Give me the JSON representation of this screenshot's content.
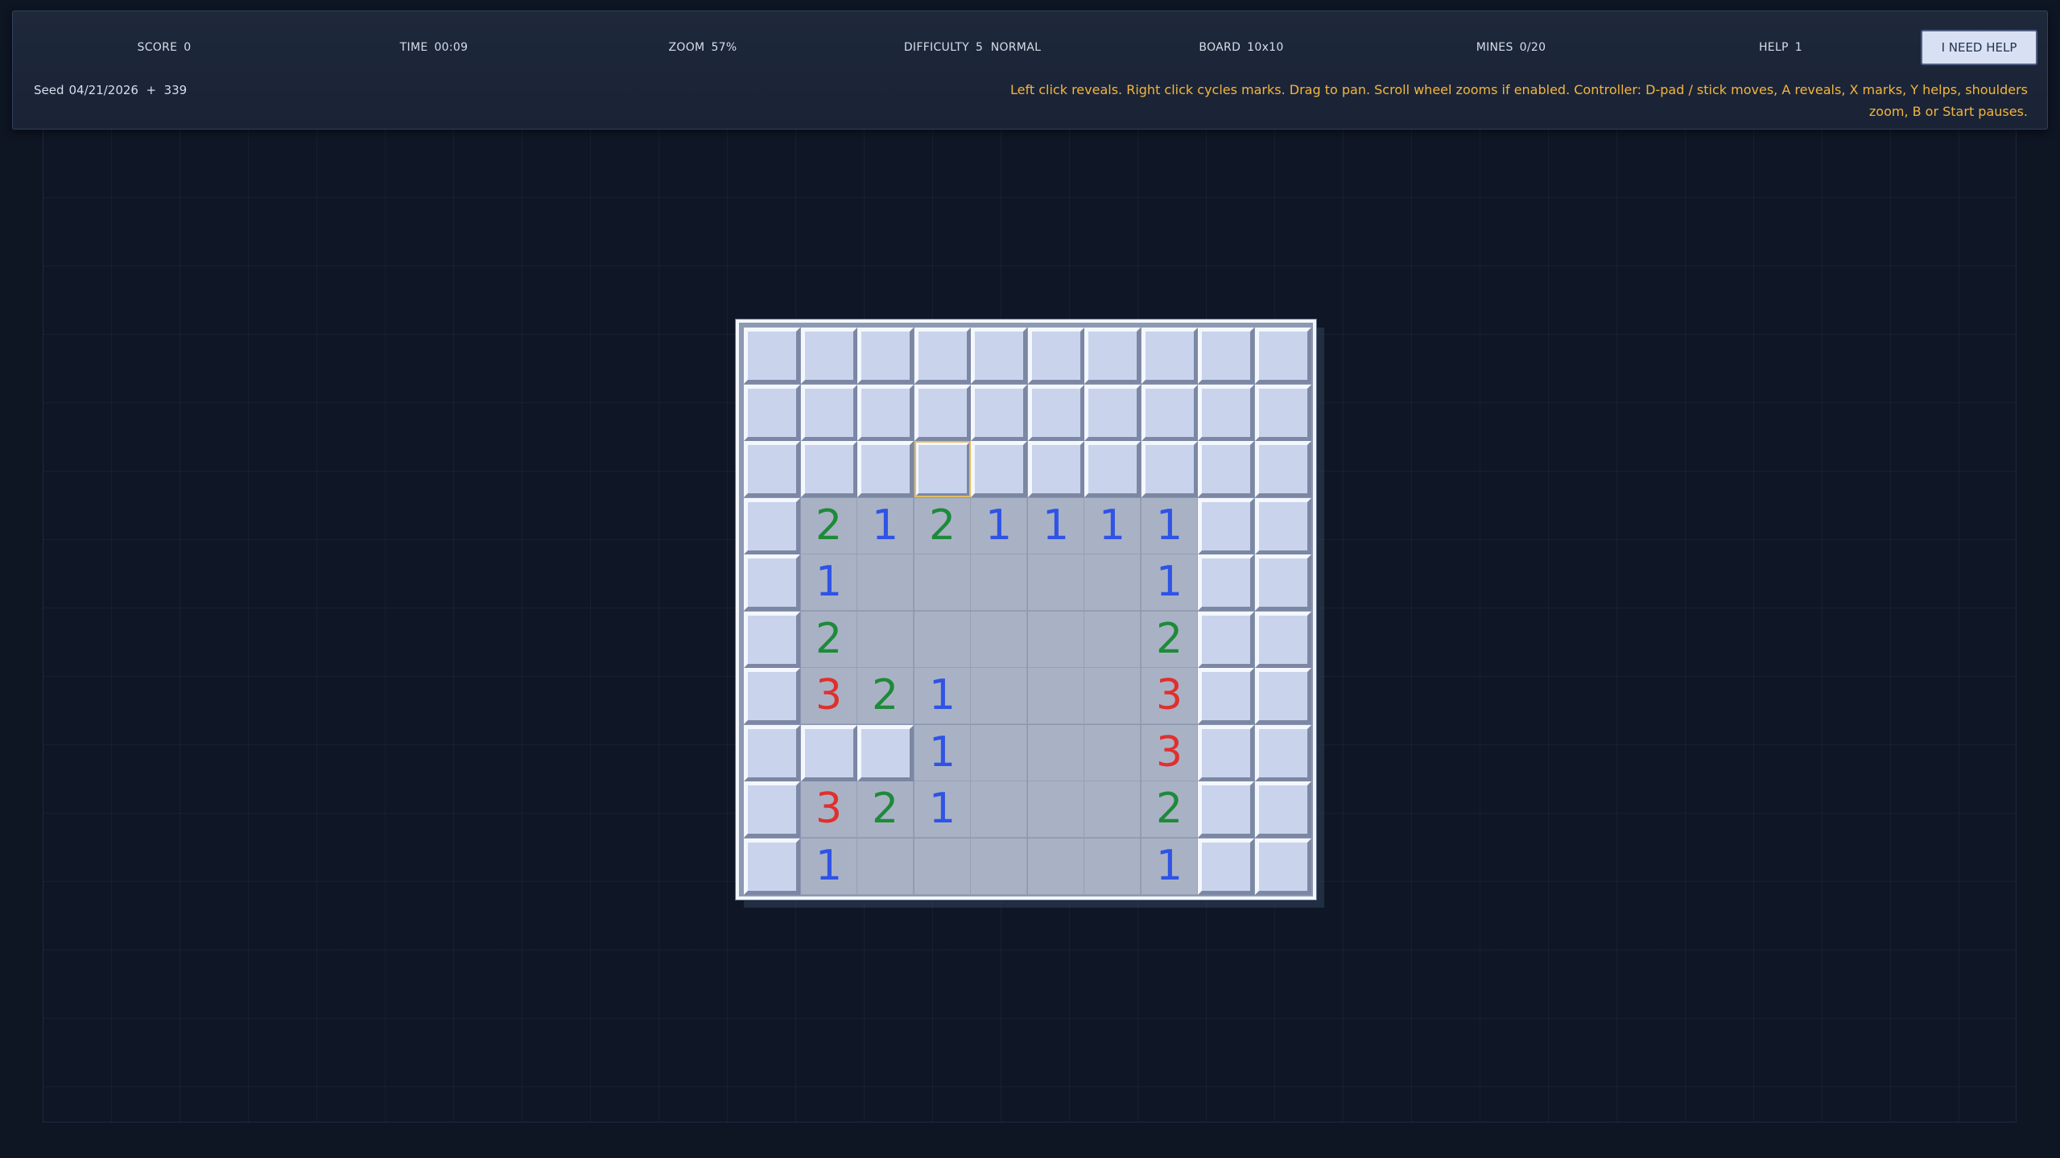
{
  "hud": {
    "stats": [
      {
        "label": "SCORE",
        "value": "0"
      },
      {
        "label": "TIME",
        "value": "00:09"
      },
      {
        "label": "ZOOM",
        "value": "57%"
      },
      {
        "label": "DIFFICULTY",
        "value": "5  NORMAL"
      },
      {
        "label": "BOARD",
        "value": "10x10"
      },
      {
        "label": "MINES",
        "value": "0/20"
      },
      {
        "label": "HELP",
        "value": "1"
      }
    ],
    "seed_label": "Seed",
    "seed_value": "04/21/2026  +  339",
    "help_button": "I NEED HELP",
    "instructions": "Left click reveals. Right click cycles marks. Drag to pan. Scroll wheel zooms if enabled. Controller: D-pad / stick moves, A reveals, X marks, Y helps, shoulders zoom, B or Start pauses."
  },
  "board": {
    "rows": 10,
    "cols": 10,
    "selected": {
      "row": 2,
      "col": 3
    },
    "grid": [
      [
        "H",
        "H",
        "H",
        "H",
        "H",
        "H",
        "H",
        "H",
        "H",
        "H"
      ],
      [
        "H",
        "H",
        "H",
        "H",
        "H",
        "H",
        "H",
        "H",
        "H",
        "H"
      ],
      [
        "H",
        "H",
        "H",
        "H",
        "H",
        "H",
        "H",
        "H",
        "H",
        "H"
      ],
      [
        "H",
        "2",
        "1",
        "2",
        "1",
        "1",
        "1",
        "1",
        "H",
        "H"
      ],
      [
        "H",
        "1",
        "0",
        "0",
        "0",
        "0",
        "0",
        "1",
        "H",
        "H"
      ],
      [
        "H",
        "2",
        "0",
        "0",
        "0",
        "0",
        "0",
        "2",
        "H",
        "H"
      ],
      [
        "H",
        "3",
        "2",
        "1",
        "0",
        "0",
        "0",
        "3",
        "H",
        "H"
      ],
      [
        "H",
        "H",
        "H",
        "1",
        "0",
        "0",
        "0",
        "3",
        "H",
        "H"
      ],
      [
        "H",
        "3",
        "2",
        "1",
        "0",
        "0",
        "0",
        "2",
        "H",
        "H"
      ],
      [
        "H",
        "1",
        "0",
        "0",
        "0",
        "0",
        "0",
        "1",
        "H",
        "H"
      ]
    ]
  }
}
